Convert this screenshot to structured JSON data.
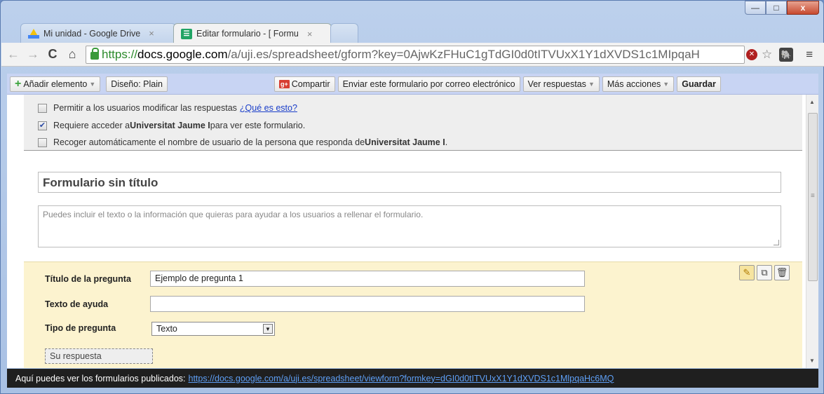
{
  "tabs": [
    {
      "label": "Mi unidad - Google Drive",
      "icon": "drive-icon",
      "active": false
    },
    {
      "label": "Editar formulario - [ Formu",
      "icon": "forms-icon",
      "active": true
    }
  ],
  "window_controls": {
    "minimize": "—",
    "maximize": "□",
    "close": "x"
  },
  "address_bar": {
    "scheme": "https://",
    "host": "docs.google.com",
    "path": "/a/uji.es/spreadsheet/gform?key=0AjwKzFHuC1gTdGI0d0tITVUxX1Y1dXVDS1c1MIpqaH"
  },
  "actionbar": {
    "add_item": "Añadir elemento",
    "design": "Diseño:  Plain",
    "share": "Compartir",
    "email_form": "Enviar este formulario por correo electrónico",
    "view_responses": "Ver respuestas",
    "more_actions": "Más acciones",
    "save": "Guardar"
  },
  "settings": {
    "allow_edit": {
      "text": "Permitir a los usuarios modificar las respuestas",
      "link": "¿Qué es esto?",
      "checked": false
    },
    "require_login": {
      "prefix": "Requiere acceder a ",
      "org": "Universitat Jaume I",
      "suffix": " para ver este formulario.",
      "checked": true
    },
    "collect_username": {
      "prefix": "Recoger automáticamente el nombre de usuario de la persona que responda de ",
      "org": "Universitat Jaume I",
      "suffix": " .",
      "checked": false
    }
  },
  "form": {
    "title": "Formulario sin título",
    "description_placeholder": "Puedes incluir el texto o la información que quieras para ayudar a los usuarios a rellenar el formulario."
  },
  "question": {
    "title_label": "Título de la pregunta",
    "title_value": "Ejemplo de pregunta 1",
    "help_label": "Texto de ayuda",
    "help_value": "",
    "type_label": "Tipo de pregunta",
    "type_value": "Texto",
    "answer_placeholder": "Su respuesta"
  },
  "footer": {
    "text": "Aquí puedes ver los formularios publicados:",
    "link": "https://docs.google.com/a/uji.es/spreadsheet/viewform?formkey=dGI0d0tITVUxX1Y1dXVDS1c1MlpqaHc6MQ"
  }
}
